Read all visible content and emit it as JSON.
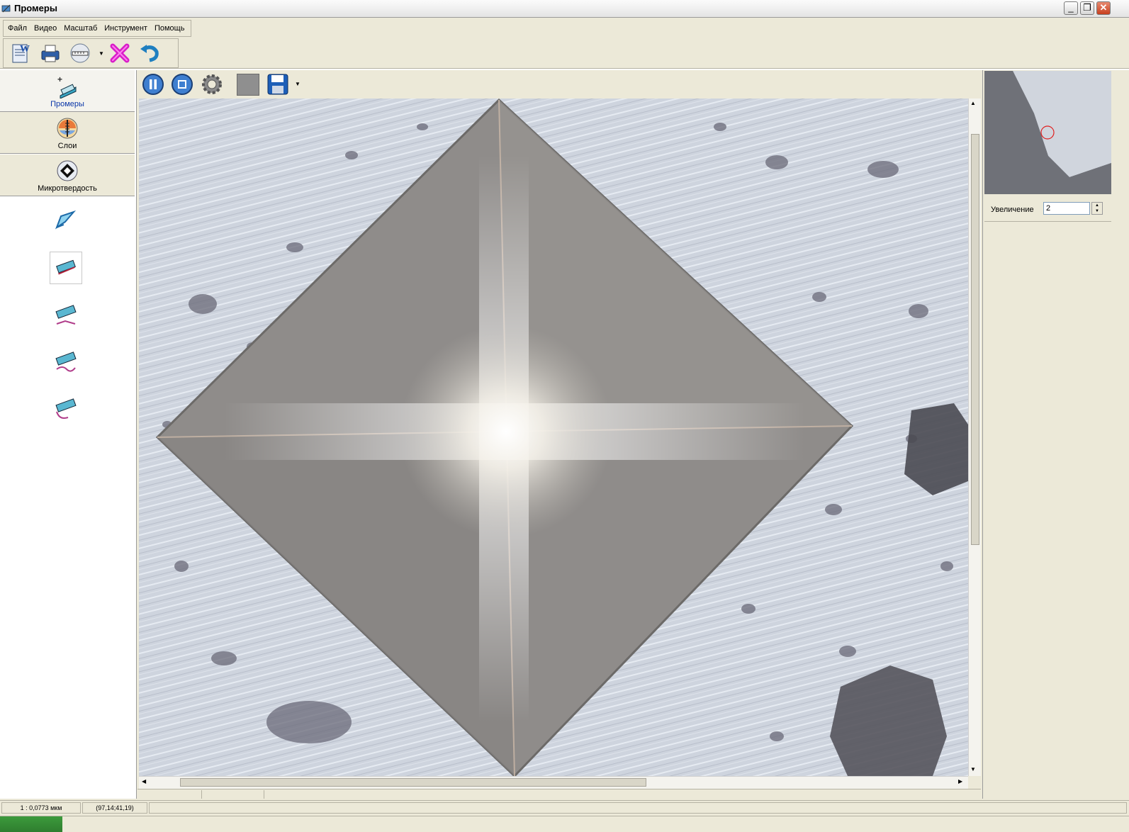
{
  "window": {
    "title": "Промеры",
    "minimize_glyph": "_",
    "restore_glyph": "❐",
    "close_glyph": "✕"
  },
  "menu": {
    "items": [
      "Файл",
      "Видео",
      "Масштаб",
      "Инструмент",
      "Помощь"
    ]
  },
  "main_toolbar": {
    "icons": [
      "word-export-icon",
      "print-icon",
      "scale-ruler-icon",
      "delete-icon",
      "undo-icon"
    ]
  },
  "left_panel": {
    "tabs": [
      {
        "label": "Промеры",
        "icon": "measure-icon",
        "active": true
      },
      {
        "label": "Слои",
        "icon": "layers-icon",
        "active": false
      },
      {
        "label": "Микротвердость",
        "icon": "microhardness-icon",
        "active": false
      }
    ],
    "tools": [
      "pointer-tool-icon",
      "line-measure-tool-icon",
      "polyline-measure-tool-icon",
      "curve-measure-tool-icon",
      "arc-measure-tool-icon"
    ]
  },
  "image_toolbar": {
    "icons": [
      "pause-icon",
      "stop-icon",
      "settings-icon",
      "color-swatch-icon",
      "save-icon"
    ]
  },
  "preview": {
    "label": "Увеличение",
    "zoom_value": "2"
  },
  "status": {
    "scale": "1 : 0,0773 мкм",
    "coords": "(97,14;41,19)"
  }
}
